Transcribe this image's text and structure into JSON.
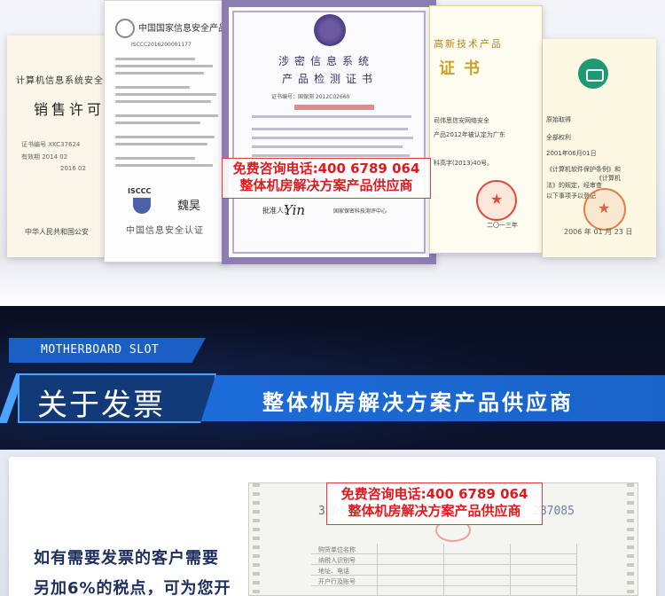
{
  "certificates": {
    "left": {
      "title": "计算机信息系统安全",
      "subtitle": "销售许可",
      "lines": [
        "证书编号 XKC37624",
        "有效期 2014 02",
        "2016 02"
      ],
      "footer": "中华人民共和国公安"
    },
    "isccc": {
      "header": "中国国家信息安全产品",
      "number": "ISCCC2016200001177",
      "brand": "ISCCC",
      "signature": "魏昊",
      "footer": "中国信息安全认证"
    },
    "product": {
      "title_line1": "涉密信息系统",
      "title_line2": "产品检测证书",
      "number": "证书编号：国保测 2012C02660",
      "approver_label": "批准人：",
      "signature": "Yin",
      "org": "国家保密科技测评中心"
    },
    "hightech": {
      "heading": "高新技术产品",
      "word": "证书",
      "lines": [
        "司伟思信安网络安全",
        "产品2012年被认定为广东",
        "科高字(2013)40号。"
      ],
      "date": "二〇一三年"
    },
    "software": {
      "lines": [
        "原始取得",
        "全部权利",
        "2001年06月01日",
        "《计算机软件保护条例》和",
        "《计算机",
        "法》的规定，经审查",
        "以下事项予以登记"
      ],
      "date": "2006 年 01 月 23 日"
    }
  },
  "promo": {
    "phone_line": "免费咨询电话:400 6789 064",
    "supplier_line": "整体机房解决方案产品供应商"
  },
  "banner": {
    "slot_label": "MOTHERBOARD SLOT",
    "section_title": "关于发票",
    "tagline": "整体机房解决方案产品供应商"
  },
  "invoice": {
    "text_line1": "如有需要发票的客户需要",
    "text_line2": "另加6%的税点，可为您开",
    "code_left": "3200",
    "code_right": "287085",
    "labels": [
      "购货单位名称",
      "纳税人识别号",
      "地址、电话",
      "开户行及账号"
    ]
  }
}
